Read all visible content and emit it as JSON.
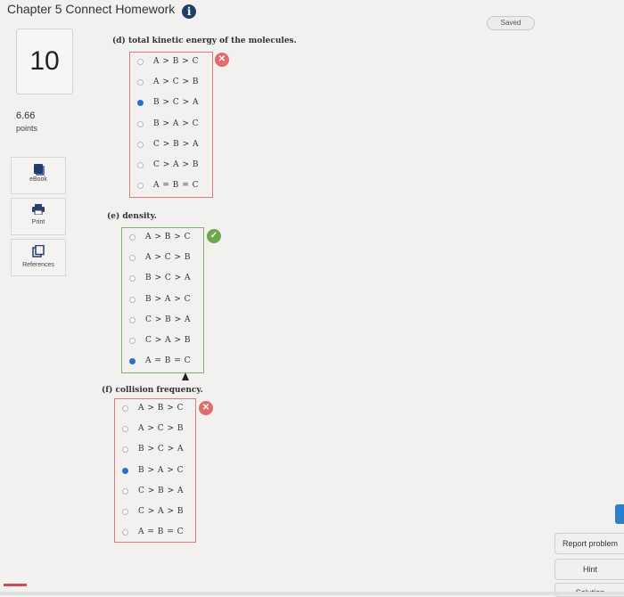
{
  "header": {
    "title": "Chapter 5 Connect Homework",
    "info_icon": "i"
  },
  "status": {
    "saved": "Saved"
  },
  "question": {
    "number": "10",
    "points_value": "6.66",
    "points_label": "points"
  },
  "tools": [
    {
      "label": "eBook",
      "icon": "book-icon"
    },
    {
      "label": "Print",
      "icon": "printer-icon"
    },
    {
      "label": "References",
      "icon": "references-icon"
    }
  ],
  "parts": [
    {
      "title": "(d) total kinetic energy of the molecules.",
      "result": "wrong",
      "result_glyph": "✕",
      "options": [
        {
          "text": "A > B > C",
          "selected": false
        },
        {
          "text": "A > C > B",
          "selected": false
        },
        {
          "text": "B > C > A",
          "selected": true
        },
        {
          "text": "B > A > C",
          "selected": false
        },
        {
          "text": "C > B > A",
          "selected": false
        },
        {
          "text": "C > A > B",
          "selected": false
        },
        {
          "text": "A = B = C",
          "selected": false
        }
      ]
    },
    {
      "title": "(e) density.",
      "result": "correct",
      "result_glyph": "✓",
      "options": [
        {
          "text": "A > B > C",
          "selected": false
        },
        {
          "text": "A > C > B",
          "selected": false
        },
        {
          "text": "B > C > A",
          "selected": false
        },
        {
          "text": "B > A > C",
          "selected": false
        },
        {
          "text": "C > B > A",
          "selected": false
        },
        {
          "text": "C > A > B",
          "selected": false
        },
        {
          "text": "A = B = C",
          "selected": true
        }
      ]
    },
    {
      "title": "(f) collision frequency.",
      "result": "wrong",
      "result_glyph": "✕",
      "options": [
        {
          "text": "A > B > C",
          "selected": false
        },
        {
          "text": "A > C > B",
          "selected": false
        },
        {
          "text": "B > C > A",
          "selected": false
        },
        {
          "text": "B > A > C",
          "selected": true
        },
        {
          "text": "C > B > A",
          "selected": false
        },
        {
          "text": "C > A > B",
          "selected": false
        },
        {
          "text": "A = B = C",
          "selected": false
        }
      ]
    }
  ],
  "side_buttons": {
    "report": "Report problem",
    "hint": "Hint",
    "solution": "Solution"
  },
  "colors": {
    "correct": "#6aaa4c",
    "wrong": "#e06d6d",
    "selected_radio": "#2a6fc9"
  }
}
